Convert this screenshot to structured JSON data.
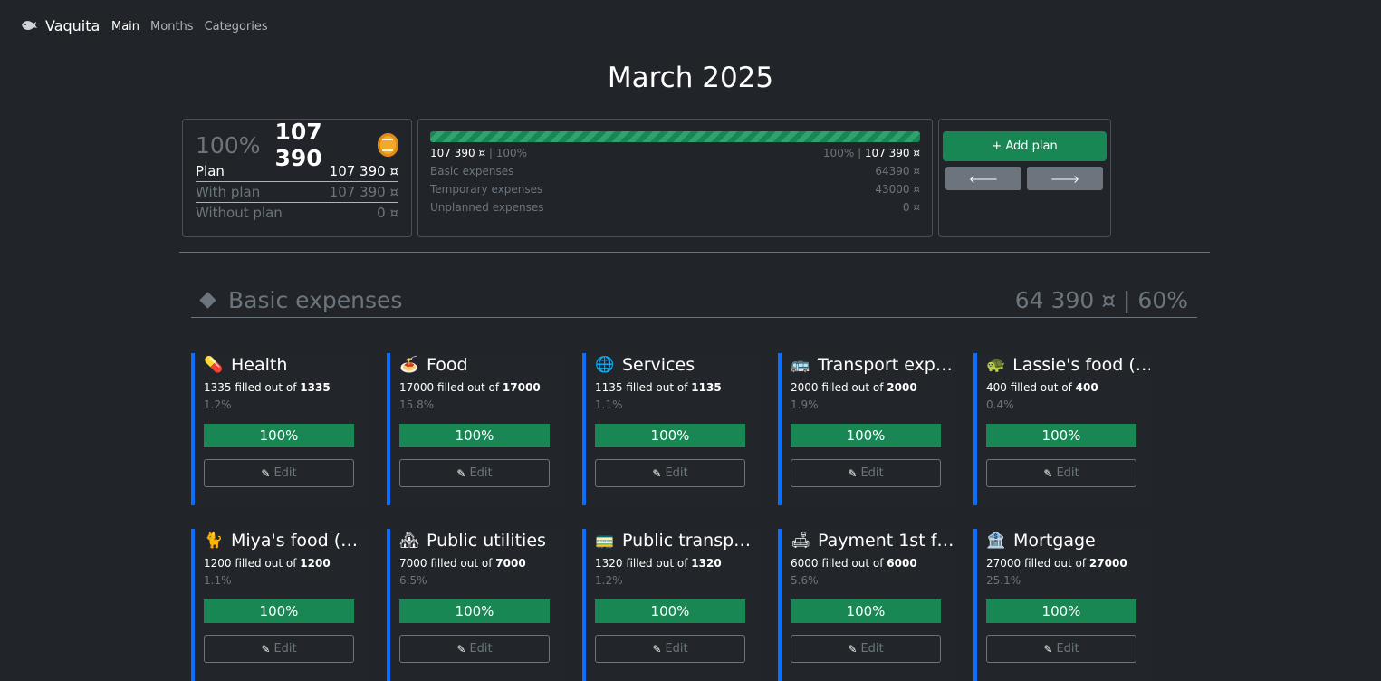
{
  "app": {
    "name": "Vaquita"
  },
  "nav": {
    "main": "Main",
    "months": "Months",
    "categories": "Categories"
  },
  "page": {
    "title": "March 2025"
  },
  "summary": {
    "percent": "100%",
    "amount": "107 390",
    "rows": [
      {
        "label": "Plan",
        "value": "107 390 ¤"
      },
      {
        "label": "With plan",
        "value": "107 390 ¤"
      },
      {
        "label": "Without plan",
        "value": "0 ¤"
      }
    ]
  },
  "progress": {
    "fill_fraction": 1.0,
    "left_amount": "107 390 ¤",
    "left_pct": "100%",
    "right_pct": "100%",
    "right_amount": "107 390 ¤",
    "rows": [
      {
        "label": "Basic expenses",
        "value": "64390 ¤"
      },
      {
        "label": "Temporary expenses",
        "value": "43000 ¤"
      },
      {
        "label": "Unplanned expenses",
        "value": "0 ¤"
      }
    ]
  },
  "actions": {
    "add_plan": "+ Add plan",
    "prev": "🡐",
    "next": "🡒"
  },
  "section": {
    "title": "Basic expenses",
    "total": "64 390 ¤ | 60%"
  },
  "card_labels": {
    "filled_mid": "filled out of",
    "edit": "Edit"
  },
  "cards": [
    {
      "icon": "💊",
      "icon_name": "pill-icon",
      "title": "Health",
      "filled": "1335",
      "total": "1335",
      "share": "1.2%",
      "progress": "100%"
    },
    {
      "icon": "🍝",
      "icon_name": "pasta-icon",
      "title": "Food",
      "filled": "17000",
      "total": "17000",
      "share": "15.8%",
      "progress": "100%"
    },
    {
      "icon": "🌐",
      "icon_name": "globe-icon",
      "title": "Services",
      "filled": "1135",
      "total": "1135",
      "share": "1.1%",
      "progress": "100%"
    },
    {
      "icon": "🚌",
      "icon_name": "bus-icon",
      "title": "Transport exp…",
      "filled": "2000",
      "total": "2000",
      "share": "1.9%",
      "progress": "100%"
    },
    {
      "icon": "🐢",
      "icon_name": "turtle-icon",
      "title": "Lassie's food (…",
      "filled": "400",
      "total": "400",
      "share": "0.4%",
      "progress": "100%"
    },
    {
      "icon": "🐈",
      "icon_name": "cat-icon",
      "title": "Miya's food (…",
      "filled": "1200",
      "total": "1200",
      "share": "1.1%",
      "progress": "100%"
    },
    {
      "icon": "🏘",
      "icon_name": "houses-icon",
      "title": "Public utilities",
      "filled": "7000",
      "total": "7000",
      "share": "6.5%",
      "progress": "100%"
    },
    {
      "icon": "🚃",
      "icon_name": "tram-icon",
      "title": "Public transp…",
      "filled": "1320",
      "total": "1320",
      "share": "1.2%",
      "progress": "100%"
    },
    {
      "icon": "🛋",
      "icon_name": "couch-icon",
      "title": "Payment 1st f…",
      "filled": "6000",
      "total": "6000",
      "share": "5.6%",
      "progress": "100%"
    },
    {
      "icon": "🏦",
      "icon_name": "bank-icon",
      "title": "Mortgage",
      "filled": "27000",
      "total": "27000",
      "share": "25.1%",
      "progress": "100%"
    }
  ]
}
